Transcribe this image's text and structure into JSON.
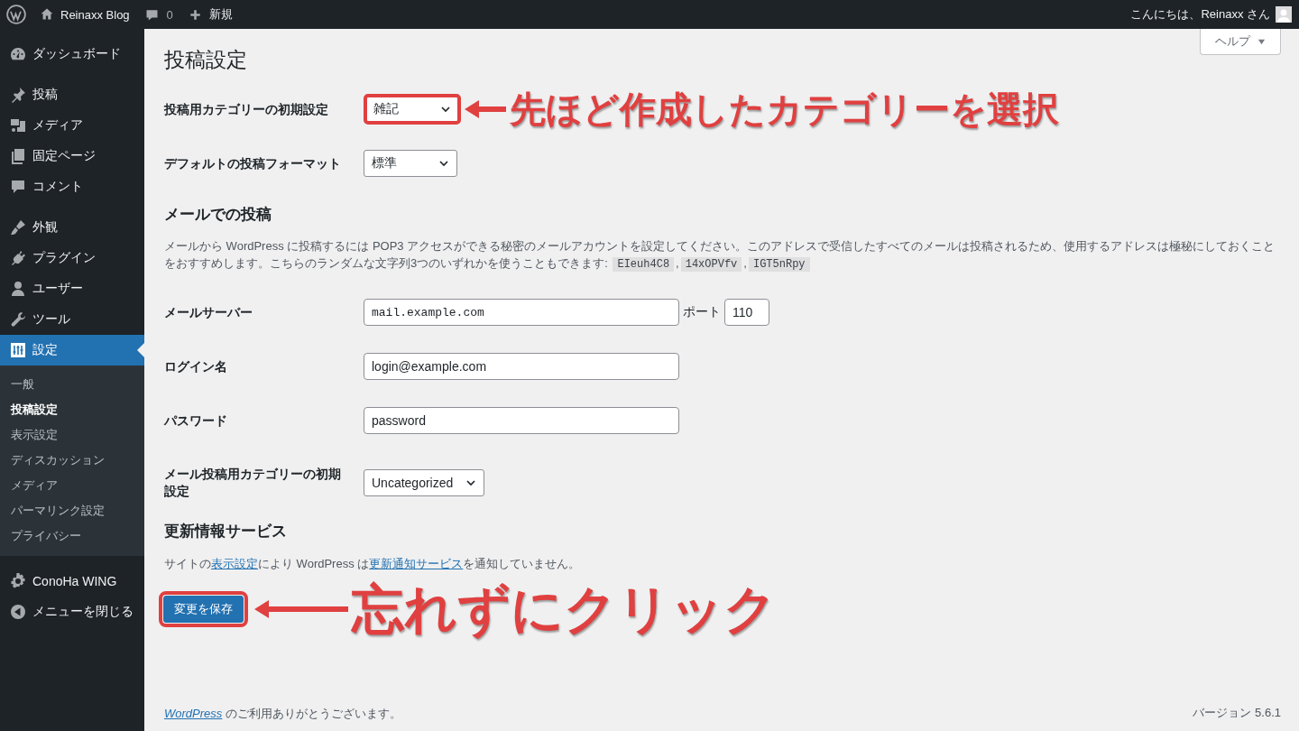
{
  "admin_bar": {
    "site_name": "Reinaxx Blog",
    "comment_count": "0",
    "new_label": "新規",
    "greeting": "こんにちは、Reinaxx さん"
  },
  "menu_groups": [
    {
      "items": [
        {
          "label": "ダッシュボード",
          "selected": false
        }
      ]
    },
    {
      "items": [
        {
          "label": "投稿",
          "selected": false
        },
        {
          "label": "メディア",
          "selected": false
        },
        {
          "label": "固定ページ",
          "selected": false
        },
        {
          "label": "コメント",
          "selected": false
        }
      ]
    },
    {
      "items": [
        {
          "label": "外観",
          "selected": false
        },
        {
          "label": "プラグイン",
          "selected": false
        },
        {
          "label": "ユーザー",
          "selected": false
        },
        {
          "label": "ツール",
          "selected": false
        },
        {
          "label": "設定",
          "selected": true,
          "children": [
            {
              "label": "一般",
              "selected": false
            },
            {
              "label": "投稿設定",
              "selected": true
            },
            {
              "label": "表示設定",
              "selected": false
            },
            {
              "label": "ディスカッション",
              "selected": false
            },
            {
              "label": "メディア",
              "selected": false
            },
            {
              "label": "パーマリンク設定",
              "selected": false
            },
            {
              "label": "プライバシー",
              "selected": false
            }
          ]
        }
      ]
    },
    {
      "items": [
        {
          "label": "ConoHa WING",
          "selected": false
        },
        {
          "label": "メニューを閉じる",
          "selected": false
        }
      ]
    }
  ],
  "help_button": "ヘルプ",
  "page_title": "投稿設定",
  "writing_settings": [
    {
      "label": "投稿用カテゴリーの初期設定",
      "kind": "select",
      "value": "雑記",
      "annotation": "先ほど作成したカテゴリーを選択"
    },
    {
      "label": "デフォルトの投稿フォーマット",
      "kind": "select",
      "value": "標準"
    }
  ],
  "post_via_email": {
    "heading": "メールでの投稿",
    "description": "メールから WordPress に投稿するには POP3 アクセスができる秘密のメールアカウントを設定してください。このアドレスで受信したすべてのメールは投稿されるため、使用するアドレスは極秘にしておくことをおすすめします。こちらのランダムな文字列3つのいずれかを使うこともできます: ",
    "codes": [
      "EIeuh4C8",
      "14xOPVfv",
      "IGT5nRpy"
    ],
    "separator": ",",
    "fields": [
      {
        "label": "メールサーバー",
        "kind": "server",
        "value": "mail.example.com",
        "port_label": "ポート",
        "port_value": "110"
      },
      {
        "label": "ログイン名",
        "kind": "text",
        "value": "login@example.com"
      },
      {
        "label": "パスワード",
        "kind": "text",
        "value": "password"
      },
      {
        "label": "メール投稿用カテゴリーの初期設定",
        "kind": "select",
        "value": "Uncategorized"
      }
    ]
  },
  "update_services": {
    "heading": "更新情報サービス",
    "parts": [
      {
        "kind": "text",
        "text": "サイトの"
      },
      {
        "kind": "link",
        "text": "表示設定"
      },
      {
        "kind": "text",
        "text": "により WordPress は"
      },
      {
        "kind": "link",
        "text": "更新通知サービス"
      },
      {
        "kind": "text",
        "text": "を通知していません。"
      }
    ]
  },
  "save_button": {
    "label": "変更を保存",
    "annotation": "忘れずにクリック"
  },
  "footer": {
    "parts": [
      {
        "kind": "link",
        "text": "WordPress"
      },
      {
        "kind": "text",
        "text": " のご利用ありがとうございます。"
      }
    ],
    "version": "バージョン 5.6.1"
  }
}
